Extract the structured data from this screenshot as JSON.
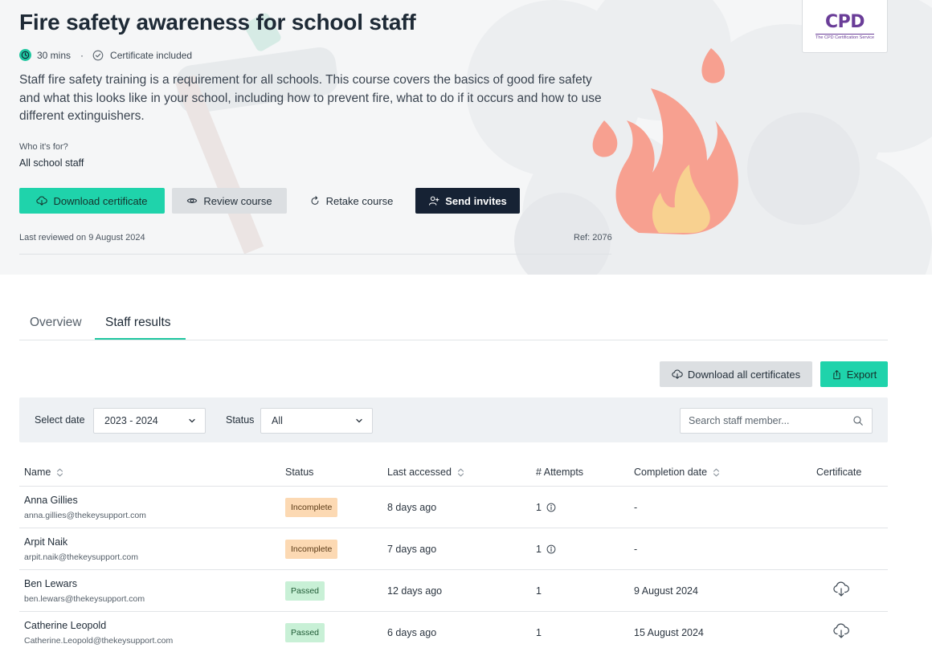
{
  "course": {
    "title": "Fire safety awareness for school staff",
    "duration": "30 mins",
    "separator": "·",
    "certificate_note": "Certificate included",
    "description": "Staff fire safety training is a requirement for all schools. This course covers the basics of good fire safety and what this looks like in your school, including how to prevent fire, what to do if it occurs and how to use different extinguishers.",
    "who_label": "Who it's for?",
    "who_value": "All school staff",
    "last_reviewed": "Last reviewed on 9 August 2024",
    "ref": "Ref: 2076"
  },
  "actions": {
    "download_certificate": "Download certificate",
    "review_course": "Review course",
    "retake_course": "Retake course",
    "send_invites": "Send invites"
  },
  "badge": {
    "logo_text": "CPD",
    "logo_sub": "The CPD Certification Service"
  },
  "tabs": [
    {
      "label": "Overview",
      "active": false
    },
    {
      "label": "Staff results",
      "active": true
    }
  ],
  "toolbar": {
    "download_all": "Download all certificates",
    "export": "Export"
  },
  "filters": {
    "date_label": "Select date",
    "date_value": "2023 - 2024",
    "status_label": "Status",
    "status_value": "All",
    "search_placeholder": "Search staff member..."
  },
  "table": {
    "columns": [
      "Name",
      "Status",
      "Last accessed",
      "# Attempts",
      "Completion date",
      "Certificate"
    ],
    "rows": [
      {
        "name": "Anna Gillies",
        "email": "anna.gillies@thekeysupport.com",
        "status": "Incomplete",
        "last_accessed": "8 days ago",
        "attempts": "1",
        "completion_date": "-",
        "has_certificate": false
      },
      {
        "name": "Arpit Naik",
        "email": "arpit.naik@thekeysupport.com",
        "status": "Incomplete",
        "last_accessed": "7 days ago",
        "attempts": "1",
        "completion_date": "-",
        "has_certificate": false
      },
      {
        "name": "Ben Lewars",
        "email": "ben.lewars@thekeysupport.com",
        "status": "Passed",
        "last_accessed": "12 days ago",
        "attempts": "1",
        "completion_date": "9 August 2024",
        "has_certificate": true
      },
      {
        "name": "Catherine Leopold",
        "email": "Catherine.Leopold@thekeysupport.com",
        "status": "Passed",
        "last_accessed": "6 days ago",
        "attempts": "1",
        "completion_date": "15 August 2024",
        "has_certificate": true
      }
    ]
  },
  "colors": {
    "accent": "#1fd3ab",
    "dark_button": "#162234",
    "incomplete_badge": "#fcd9b3",
    "passed_badge": "#c8f0d6",
    "flame": "#f7a090",
    "flame_inner": "#f8d190"
  },
  "icons": [
    "clock-icon",
    "certificate-check-icon",
    "cloud-download-icon",
    "eye-icon",
    "retake-icon",
    "add-user-icon",
    "cloud-download-icon",
    "share-export-icon",
    "chevron-down-icon",
    "search-icon",
    "sort-icon",
    "info-icon"
  ]
}
